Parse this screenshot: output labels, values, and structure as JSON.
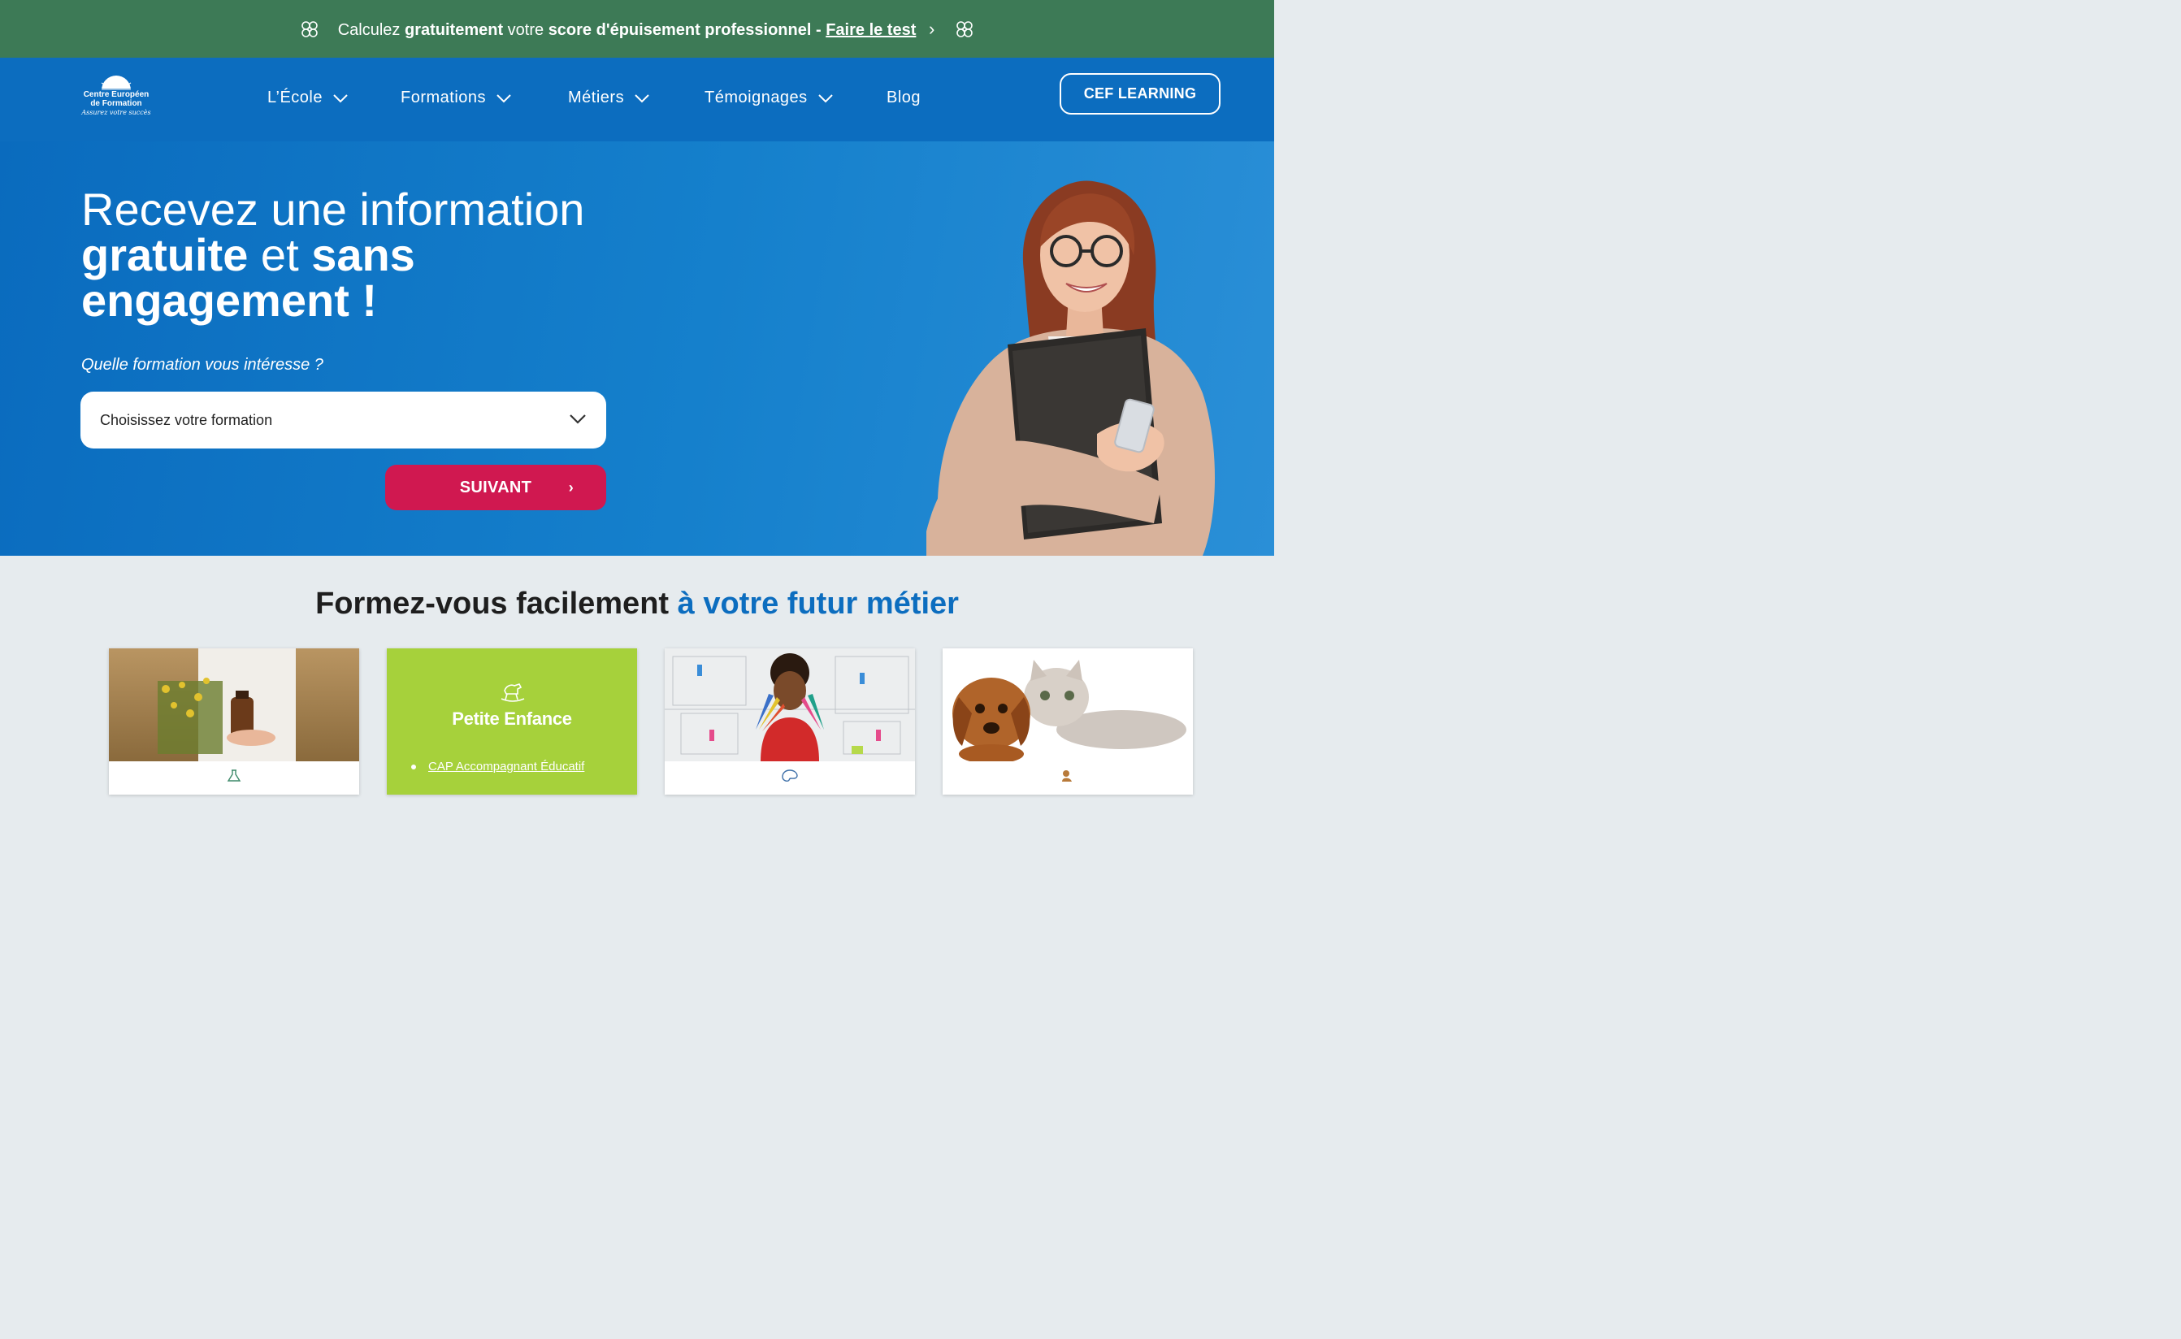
{
  "promo": {
    "text_1": "Calculez ",
    "bold_1": "gratuitement",
    "text_2": " votre ",
    "bold_2": "score d'épuisement professionnel -",
    "link": "Faire le test"
  },
  "logo": {
    "line1": "Centre Européen",
    "line2": "de Formation",
    "tagline": "Assurez votre succès"
  },
  "nav": {
    "items": [
      {
        "label": "L’École"
      },
      {
        "label": "Formations"
      },
      {
        "label": "Métiers"
      },
      {
        "label": "Témoignages"
      },
      {
        "label": "Blog"
      }
    ],
    "cta": "CEF LEARNING"
  },
  "hero": {
    "title_line1": "Recevez une information",
    "title_bold1": "gratuite",
    "title_mid": " et ",
    "title_bold2": "sans",
    "title_bold3": "engagement !",
    "question": "Quelle formation vous intéresse ?",
    "select_value": "Choisissez votre formation",
    "next_label": "SUIVANT",
    "next_arrow": "›"
  },
  "section": {
    "title_main": "Formez-vous facilement ",
    "title_accent": "à votre futur métier"
  },
  "cards": {
    "green": {
      "title": "Petite Enfance",
      "item": "CAP Accompagnant Éducatif"
    }
  },
  "colors": {
    "promo_bg": "#3d7a56",
    "header_bg": "#0c6dbf",
    "cta_red": "#d01850",
    "accent_blue": "#0c6dbf",
    "card_green": "#a6d13b"
  }
}
